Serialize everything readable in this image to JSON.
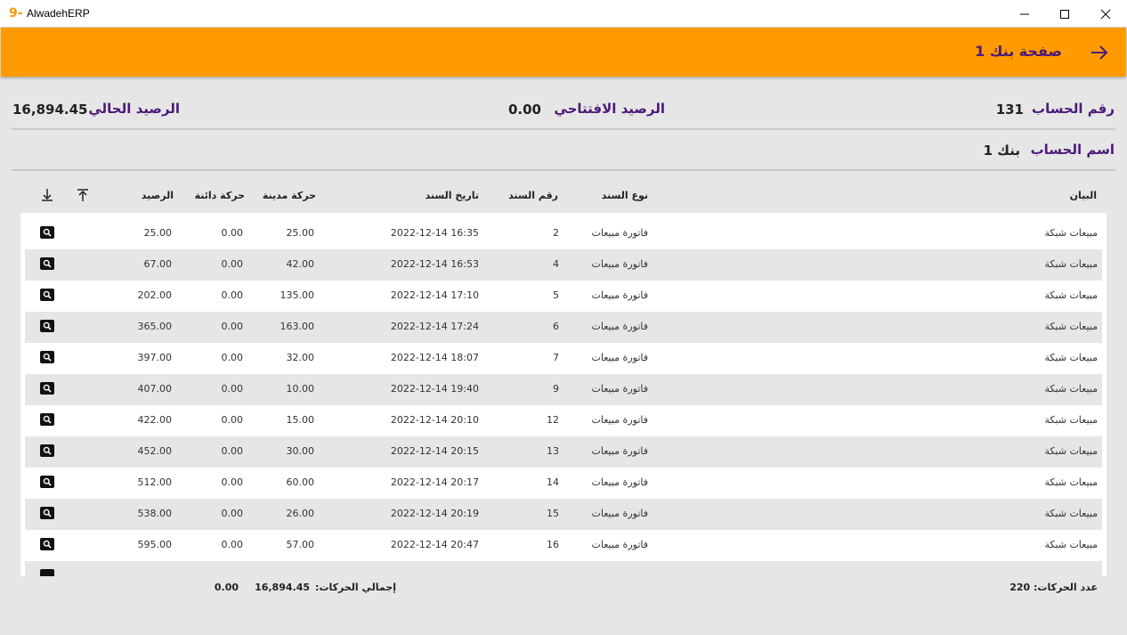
{
  "window": {
    "title": "AlwadehERP",
    "logo_glyph": "9-",
    "controls": [
      "minimize-icon",
      "maximize-icon",
      "close-icon"
    ]
  },
  "header": {
    "title": "صفحة بنك 1",
    "back_icon": "arrow-right-icon",
    "color": "#ff9a00"
  },
  "summary": {
    "account_number_label": "رقم الحساب",
    "account_number": "131",
    "opening_balance_label": "الرصيد الافتتاحي",
    "opening_balance": "0.00",
    "current_balance_label": "الرصيد الحالي",
    "current_balance": "16,894.45",
    "account_name_label": "اسم الحساب",
    "account_name": "بنك 1"
  },
  "table": {
    "columns": {
      "statement": "البيان",
      "voucher_type": "نوع السند",
      "voucher_number": "رقم السند",
      "voucher_date": "تاريخ السند",
      "debit": "حركة مدينة",
      "credit": "حركة دائنة",
      "balance": "الرصيد"
    },
    "rows": [
      {
        "statement": "مبيعات شبكة",
        "type": "فاتورة مبيعات",
        "number": "2",
        "date": "2022-12-14 16:35",
        "debit": "25.00",
        "credit": "0.00",
        "balance": "25.00"
      },
      {
        "statement": "مبيعات شبكة",
        "type": "فاتورة مبيعات",
        "number": "4",
        "date": "2022-12-14 16:53",
        "debit": "42.00",
        "credit": "0.00",
        "balance": "67.00"
      },
      {
        "statement": "مبيعات شبكة",
        "type": "فاتورة مبيعات",
        "number": "5",
        "date": "2022-12-14 17:10",
        "debit": "135.00",
        "credit": "0.00",
        "balance": "202.00"
      },
      {
        "statement": "مبيعات شبكة",
        "type": "فاتورة مبيعات",
        "number": "6",
        "date": "2022-12-14 17:24",
        "debit": "163.00",
        "credit": "0.00",
        "balance": "365.00"
      },
      {
        "statement": "مبيعات شبكة",
        "type": "فاتورة مبيعات",
        "number": "7",
        "date": "2022-12-14 18:07",
        "debit": "32.00",
        "credit": "0.00",
        "balance": "397.00"
      },
      {
        "statement": "مبيعات شبكة",
        "type": "فاتورة مبيعات",
        "number": "9",
        "date": "2022-12-14 19:40",
        "debit": "10.00",
        "credit": "0.00",
        "balance": "407.00"
      },
      {
        "statement": "مبيعات شبكة",
        "type": "فاتورة مبيعات",
        "number": "12",
        "date": "2022-12-14 20:10",
        "debit": "15.00",
        "credit": "0.00",
        "balance": "422.00"
      },
      {
        "statement": "مبيعات شبكة",
        "type": "فاتورة مبيعات",
        "number": "13",
        "date": "2022-12-14 20:15",
        "debit": "30.00",
        "credit": "0.00",
        "balance": "452.00"
      },
      {
        "statement": "مبيعات شبكة",
        "type": "فاتورة مبيعات",
        "number": "14",
        "date": "2022-12-14 20:17",
        "debit": "60.00",
        "credit": "0.00",
        "balance": "512.00"
      },
      {
        "statement": "مبيعات شبكة",
        "type": "فاتورة مبيعات",
        "number": "15",
        "date": "2022-12-14 20:19",
        "debit": "26.00",
        "credit": "0.00",
        "balance": "538.00"
      },
      {
        "statement": "مبيعات شبكة",
        "type": "فاتورة مبيعات",
        "number": "16",
        "date": "2022-12-14 20:47",
        "debit": "57.00",
        "credit": "0.00",
        "balance": "595.00"
      }
    ]
  },
  "footer": {
    "count_text": "عدد الحركات: 220",
    "total_label": "إجمالي الحركات:",
    "total_debit": "16,894.45",
    "total_credit": "0.00"
  }
}
